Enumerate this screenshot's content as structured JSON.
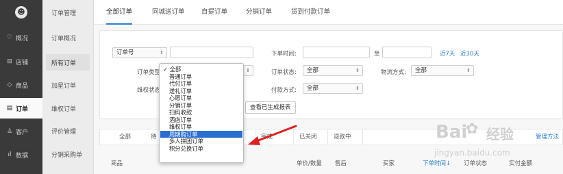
{
  "sidebar": {
    "logo": "☻",
    "items": [
      {
        "icon": "♡",
        "label": "概况"
      },
      {
        "icon": "⊟",
        "label": "店铺"
      },
      {
        "icon": "◇",
        "label": "商品"
      },
      {
        "icon": "▤",
        "label": "订单"
      },
      {
        "icon": "♙",
        "label": "客户"
      },
      {
        "icon": "ıl",
        "label": "数据"
      }
    ]
  },
  "submenu": {
    "items": [
      "订单管理",
      "订单概况",
      "所有订单",
      "加星订单",
      "维权订单",
      "评价管理",
      "分销采购单"
    ]
  },
  "tabs": [
    "全部订单",
    "同城送订单",
    "自提订单",
    "分销订单",
    "货到付款订单"
  ],
  "filter": {
    "order_no_select": "订单号",
    "order_time_label": "下单时间:",
    "range_sep": "至",
    "last7": "近7天",
    "last30": "近30天",
    "order_type_label": "订单类型:",
    "order_status_label": "订单状态:",
    "order_status_value": "全部",
    "logistics_label": "物流方式:",
    "logistics_value": "全部",
    "rights_label": "维权状态:",
    "payment_label": "付款方式:",
    "payment_value": "全部",
    "report_button": "查看已生成报表"
  },
  "dropdown": {
    "items": [
      "全部",
      "普通订单",
      "代付订单",
      "送礼订单",
      "心愿订单",
      "分销订单",
      "扫码收款",
      "酒店订单",
      "维权订单",
      "周期购订单",
      "多人拼团订单",
      "积分兑换订单"
    ],
    "checked": "✓",
    "highlighted": "周期购订单"
  },
  "status_tabs": [
    "全部",
    "待",
    "完成",
    "已关闭",
    "退款中"
  ],
  "right_link": "管理方法",
  "columns": [
    "商品",
    "单价/数量",
    "售后",
    "买家",
    "下单时间↓",
    "订单状态",
    "实付金额"
  ],
  "watermark": {
    "brand": "Bai",
    "mid": "经验",
    "url": "jingyan.baidu.com"
  },
  "colors": {
    "accent": "#2a7fd4",
    "highlight": "#2a6fd0",
    "sidebar": "#3a3a3a",
    "arrow": "#e02020"
  }
}
